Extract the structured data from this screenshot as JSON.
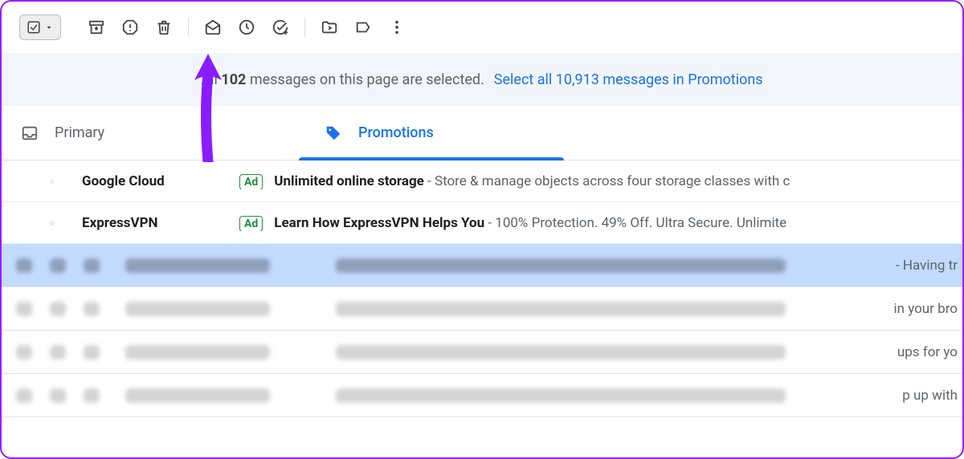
{
  "toolbar": {
    "select_checked": true
  },
  "banner": {
    "prefix": "All ",
    "count": "102",
    "suffix": " messages on this page are selected.",
    "link": "Select all 10,913 messages in Promotions"
  },
  "tabs": {
    "primary": "Primary",
    "promotions": "Promotions"
  },
  "ads": [
    {
      "sender": "Google Cloud",
      "badge": "Ad",
      "subject": "Unlimited online storage",
      "snippet": " - Store & manage objects across four storage classes with c"
    },
    {
      "sender": "ExpressVPN",
      "badge": "Ad",
      "subject": "Learn How ExpressVPN Helps You",
      "snippet": " - 100% Protection. 49% Off. Ultra Secure. Unlimite"
    }
  ],
  "blurred": [
    {
      "selected": true,
      "snippet": " - Having tr"
    },
    {
      "selected": false,
      "snippet": "in your bro"
    },
    {
      "selected": false,
      "snippet": "ups for yo"
    },
    {
      "selected": false,
      "snippet": "p up with"
    }
  ]
}
